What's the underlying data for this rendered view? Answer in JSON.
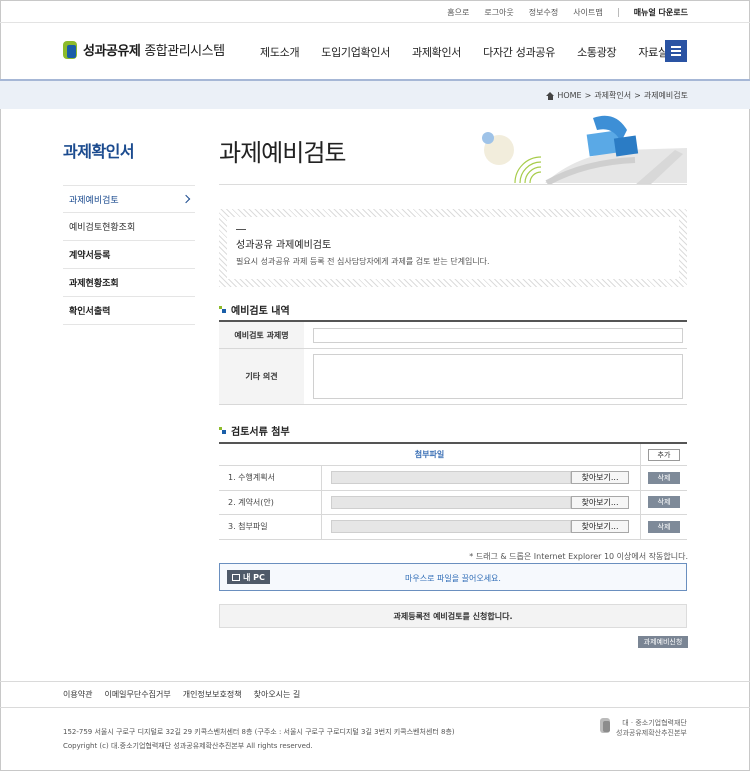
{
  "util": {
    "links": [
      "홈으로",
      "로그아웃",
      "정보수정",
      "사이트맵"
    ],
    "download": "매뉴얼 다운로드"
  },
  "header": {
    "logo_main": "성과공유제",
    "logo_sub": "종합관리시스템",
    "nav": [
      "제도소개",
      "도입기업확인서",
      "과제확인서",
      "다자간 성과공유",
      "소통광장",
      "자료실"
    ]
  },
  "breadcrumb": {
    "home": "HOME",
    "level1": "과제확인서",
    "level2": "과제예비검토"
  },
  "sidebar": {
    "title": "과제확인서",
    "items": [
      {
        "label": "과제예비검토"
      },
      {
        "label": "예비검토현황조회"
      },
      {
        "label": "계약서등록"
      },
      {
        "label": "과제현황조회"
      },
      {
        "label": "확인서출력"
      }
    ]
  },
  "page": {
    "title": "과제예비검토"
  },
  "intro": {
    "title": "성과공유 과제예비검토",
    "desc": "필요시 성과공유 과제 등록 전 심사담당자에게 과제를 검토 받는 단계입니다."
  },
  "section1": {
    "title": "예비검토 내역",
    "field_name_label": "예비검토 과제명",
    "field_name_value": "",
    "field_comment_label": "기타 의견",
    "field_comment_value": ""
  },
  "section2": {
    "title": "검토서류 첨부",
    "header": "첨부파일",
    "add_label": "추가",
    "browse_label": "찾아보기...",
    "delete_label": "삭제",
    "rows": [
      {
        "label": "1. 수행계획서"
      },
      {
        "label": "2. 계약서(안)"
      },
      {
        "label": "3. 첨부파일"
      }
    ]
  },
  "dnd": {
    "note": "* 드래그 & 드롭은 Internet Explorer 10 이상에서 작동합니다.",
    "mypc": "내 PC",
    "text": "마우스로 파일을 끌어오세요."
  },
  "apply": {
    "message": "과제등록전 예비검토를 신청합니다.",
    "button": "과제예비신청"
  },
  "footer": {
    "links": [
      "이용약관",
      "이메일무단수집거부",
      "개인정보보호정책",
      "찾아오시는 길"
    ],
    "address": "152-759 서울시 구로구 디지털로 32길 29 키콕스벤처센터 8층 (구주소 : 서울시 구로구 구로디지털 3길 3번지 키콕스벤처센터 8층)",
    "copyright": "Copyright (c) 대.중소기업협력재단 성과공유제확산추진본부 All rights reserved.",
    "org_line1": "대 · 중소기업협력재단",
    "org_line2": "성과공유제확산추진본부"
  },
  "colors": {
    "brand_blue": "#1b4b8f",
    "brand_green": "#8dbb2b",
    "menu_button": "#2a53a3",
    "breadcrumb_bg": "#ebf0f7"
  }
}
